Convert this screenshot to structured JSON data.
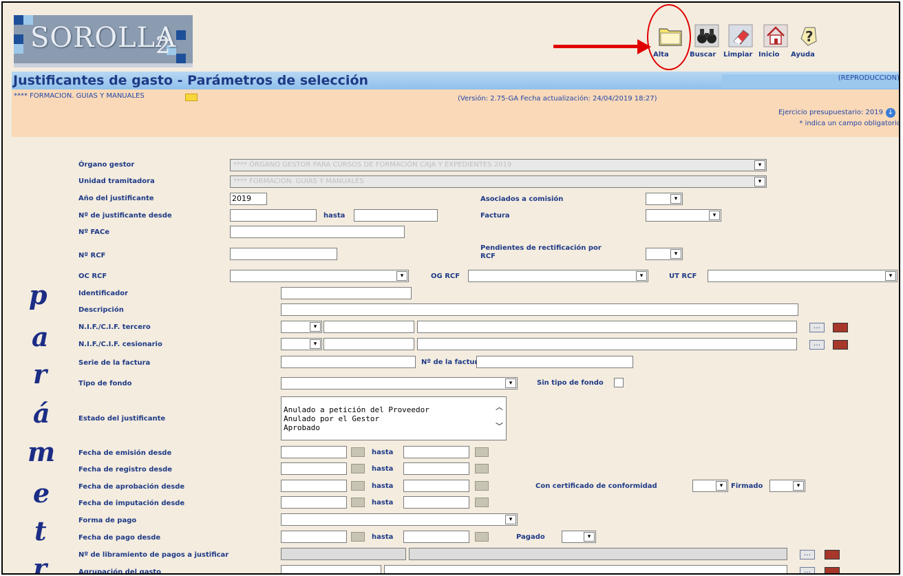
{
  "app": {
    "logo_text": "SOROLLA"
  },
  "toolbar": {
    "items": [
      {
        "label": "Alta",
        "icon": "folder-icon"
      },
      {
        "label": "Buscar",
        "icon": "binoculars-icon"
      },
      {
        "label": "Limpiar",
        "icon": "eraser-icon"
      },
      {
        "label": "Inicio",
        "icon": "home-icon"
      },
      {
        "label": "Ayuda",
        "icon": "help-icon"
      }
    ]
  },
  "header": {
    "title": "Justificantes de gasto - Parámetros de selección",
    "mode": "(REPRODUCCION)",
    "unit": "**** FORMACION. GUIAS Y MANUALES",
    "version": "(Versión: 2.75-GA Fecha actualización: 24/04/2019 18:27)",
    "ejercicio": "Ejercicio presupuestario: 2019",
    "obligatorio": "* indica un campo obligatorio"
  },
  "side_word": [
    "p",
    "a",
    "r",
    "á",
    "m",
    "e",
    "t",
    "r"
  ],
  "form": {
    "organo_gestor": {
      "label": "Órgano gestor",
      "value": "**** ÓRGANO GESTOR PARA CURSOS DE FORMACIÓN CAJA Y EXPEDIENTES 2019"
    },
    "unidad_tramitadora": {
      "label": "Unidad tramitadora",
      "value": "**** FORMACION. GUIAS Y MANUALES"
    },
    "anio": {
      "label": "Año del justificante",
      "value": "2019"
    },
    "asociados": {
      "label": "Asociados a comisión"
    },
    "num_desde": {
      "label": "Nº de justificante desde"
    },
    "hasta": "hasta",
    "factura": {
      "label": "Factura"
    },
    "face": {
      "label": "Nº FACe"
    },
    "rcf": {
      "label": "Nº RCF"
    },
    "pendientes": {
      "label1": "Pendientes de rectificación por",
      "label2": "RCF"
    },
    "oc_rcf": {
      "label": "OC RCF"
    },
    "og_rcf": {
      "label": "OG RCF"
    },
    "ut_rcf": {
      "label": "UT RCF"
    },
    "identificador": {
      "label": "Identificador"
    },
    "descripcion": {
      "label": "Descripción"
    },
    "nif_tercero": {
      "label": "N.I.F./C.I.F. tercero"
    },
    "nif_cesionario": {
      "label": "N.I.F./C.I.F. cesionario"
    },
    "serie_factura": {
      "label": "Serie de la factura"
    },
    "num_factura": {
      "label": "Nº de la factura"
    },
    "tipo_fondo": {
      "label": "Tipo de fondo"
    },
    "sin_tipo_fondo": {
      "label": "Sin tipo de fondo"
    },
    "estado": {
      "label": "Estado del justificante",
      "options": [
        "Anulado a petición del Proveedor",
        "Anulado por el Gestor",
        "Aprobado"
      ]
    },
    "fecha_emision": {
      "label": "Fecha de emisión desde"
    },
    "fecha_registro": {
      "label": "Fecha de registro desde"
    },
    "fecha_aprobacion": {
      "label": "Fecha de aprobación desde"
    },
    "con_certificado": {
      "label": "Con certificado de conformidad"
    },
    "firmado": {
      "label": "Firmado"
    },
    "fecha_imputacion": {
      "label": "Fecha de imputación desde"
    },
    "forma_pago": {
      "label": "Forma de pago"
    },
    "fecha_pago": {
      "label": "Fecha de pago desde"
    },
    "pagado": {
      "label": "Pagado"
    },
    "libramiento": {
      "label": "Nº de libramiento de pagos a justificar"
    },
    "agrupacion": {
      "label": "Agrupación del gasto"
    }
  },
  "colors": {
    "label": "#1f3a86",
    "title_bar": "#a9cdef",
    "info_bar": "#f9d9b8",
    "annotation": "#e00000"
  }
}
